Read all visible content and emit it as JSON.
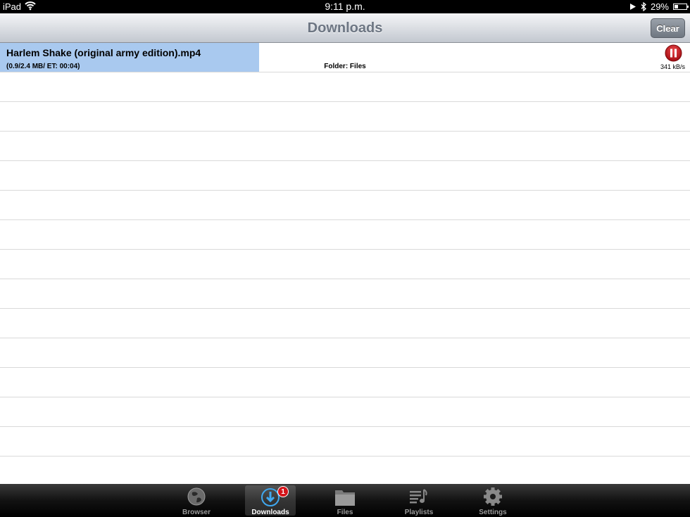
{
  "status_bar": {
    "device": "iPad",
    "time": "9:11 p.m.",
    "battery_text": "29%",
    "battery_level": 0.29
  },
  "navbar": {
    "title": "Downloads",
    "clear_label": "Clear"
  },
  "downloads": [
    {
      "filename": "Harlem Shake (original army edition).mp4",
      "size_info": "(0.9/2.4 MB/ ET: 00:04)",
      "folder": "Folder: Files",
      "speed": "341 kB/s",
      "progress": 0.375
    }
  ],
  "colors": {
    "progress": "#a9c9ef",
    "pause_button": "#c8161c",
    "badge": "#d4141a"
  },
  "tabbar": {
    "tabs": [
      {
        "label": "Browser",
        "icon": "globe-icon"
      },
      {
        "label": "Downloads",
        "icon": "download-icon",
        "badge": "1",
        "active": true
      },
      {
        "label": "Files",
        "icon": "folder-icon"
      },
      {
        "label": "Playlists",
        "icon": "playlist-icon"
      },
      {
        "label": "Settings",
        "icon": "gear-icon"
      }
    ]
  }
}
